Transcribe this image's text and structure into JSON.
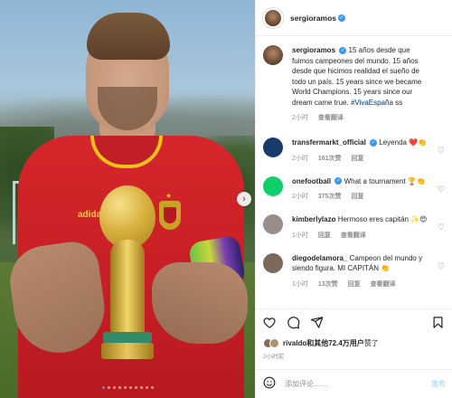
{
  "header": {
    "username": "sergioramos",
    "verified_icon": "verified-badge-icon"
  },
  "caption": {
    "username": "sergioramos",
    "text_es": "15 años desde que fuimos campeones del mundo. 15 años desde que hicimos realidad el sueño de todo un país.",
    "text_en": "15 years since we became World Champions. 15 years since our dream came true.",
    "hashtag": "#VivaEspaña",
    "hashtag_suffix": "ss",
    "time": "2小时",
    "translate": "查看翻译"
  },
  "comments": [
    {
      "username": "transfermarkt_official",
      "text": "Leyenda ❤️👏",
      "time": "2小时",
      "likes": "161次赞",
      "reply": "回复",
      "avatar_color": "#1a3a6b"
    },
    {
      "username": "onefootball",
      "text": "What a tournament 🏆👏",
      "time": "2小时",
      "likes": "375次赞",
      "reply": "回复",
      "avatar_color": "#0fcf6b"
    },
    {
      "username": "kimberlylazo",
      "text": "Hermoso eres capitán ✨😍",
      "time": "1小时",
      "reply": "回复",
      "translate": "查看翻译",
      "avatar_color": "#9a8d87"
    },
    {
      "username": "diegodelamora_",
      "text": "Campeon del mundo y siendo figura. MI CAPITÁN 👏",
      "time": "1小时",
      "likes": "13次赞",
      "reply": "回复",
      "translate": "查看翻译",
      "avatar_color": "#7b6a5c"
    }
  ],
  "actions": {
    "like_icon": "heart-icon",
    "comment_icon": "comment-icon",
    "share_icon": "send-icon",
    "save_icon": "bookmark-icon"
  },
  "likes": {
    "user": "rivaldo",
    "text": "和其他72.4万用户",
    "suffix": "赞了"
  },
  "posted_ago": "2小时前",
  "add_comment": {
    "placeholder": "添加评论……",
    "post_label": "发布"
  },
  "carousel": {
    "dot_count": 10,
    "active_index": 0
  },
  "colors": {
    "link": "#00376b",
    "verified": "#3897f0",
    "muted": "#8e8e8e",
    "post_disabled": "#b2dffc"
  }
}
